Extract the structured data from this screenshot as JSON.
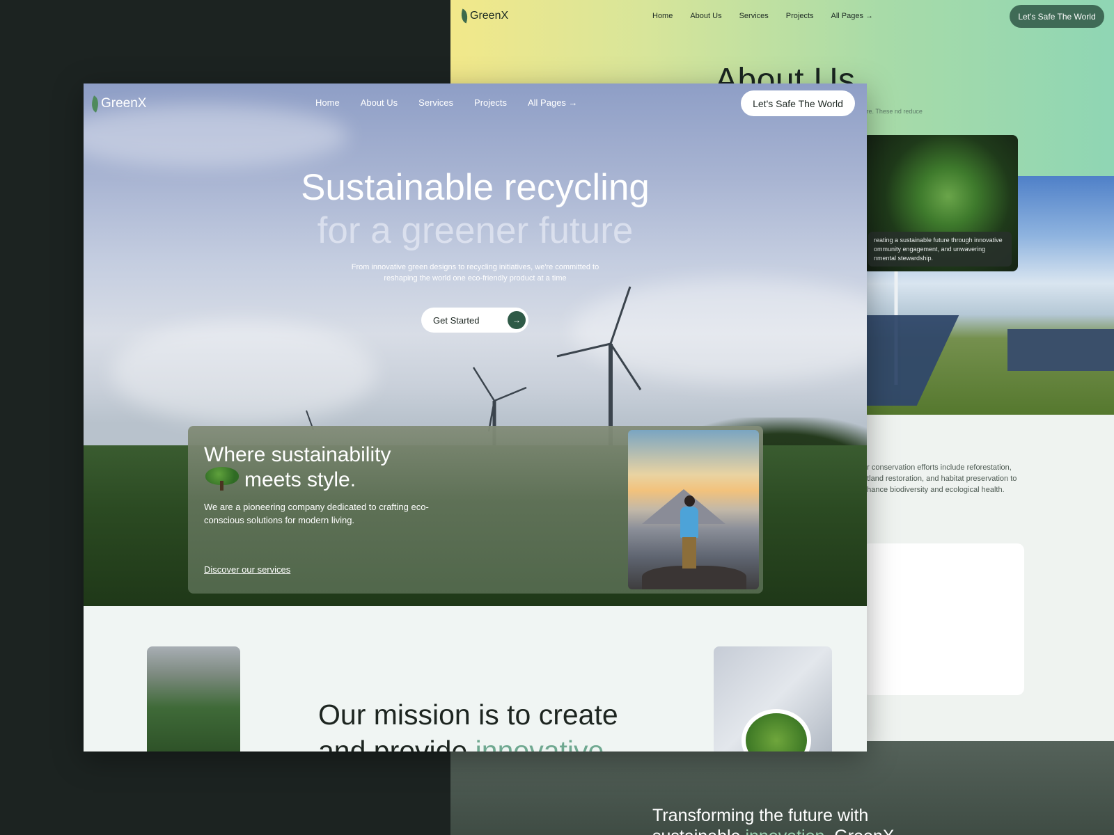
{
  "back_page": {
    "logo": "GreenX",
    "nav": [
      "Home",
      "About Us",
      "Services",
      "Projects",
      "All Pages →"
    ],
    "cta": "Let's Safe The World",
    "title": "About Us",
    "small_text": "ture. These nd reduce",
    "conservation_text": "ur conservation efforts include reforestation, etland restoration, and habitat preservation to nhance biodiversity and ecological health.",
    "card_text": "reating a sustainable future through innovative ommunity engagement, and unwavering nmental stewardship.",
    "footer_title_line1": "Transforming the future with",
    "footer_title_line2_plain": "sustainable ",
    "footer_title_line2_accent": "innovation",
    "footer_title_line2_end": ", GreenX"
  },
  "front_page": {
    "logo": "GreenX",
    "nav": [
      "Home",
      "About Us",
      "Services",
      "Projects",
      "All Pages →"
    ],
    "cta": "Let's Safe The World",
    "hero": {
      "title_line1": "Sustainable recycling",
      "title_line2": "for a greener future",
      "subtitle": "From innovative green designs to recycling initiatives, we're committed to reshaping the world one eco-friendly product at a time",
      "button": "Get Started",
      "button_icon": "→"
    },
    "card": {
      "title_line1": "Where sustainability",
      "title_line2": "meets style.",
      "description": "We are a pioneering company dedicated to crafting eco-conscious solutions for modern living.",
      "link": "Discover our services"
    },
    "mission": {
      "title_line1": "Our mission is to create",
      "title_line2_plain": "and provide ",
      "title_line2_accent": "innovative"
    }
  },
  "colors": {
    "background": "#1c2321",
    "accent_green": "#2f5a47",
    "accent_text": "#6fa890"
  }
}
